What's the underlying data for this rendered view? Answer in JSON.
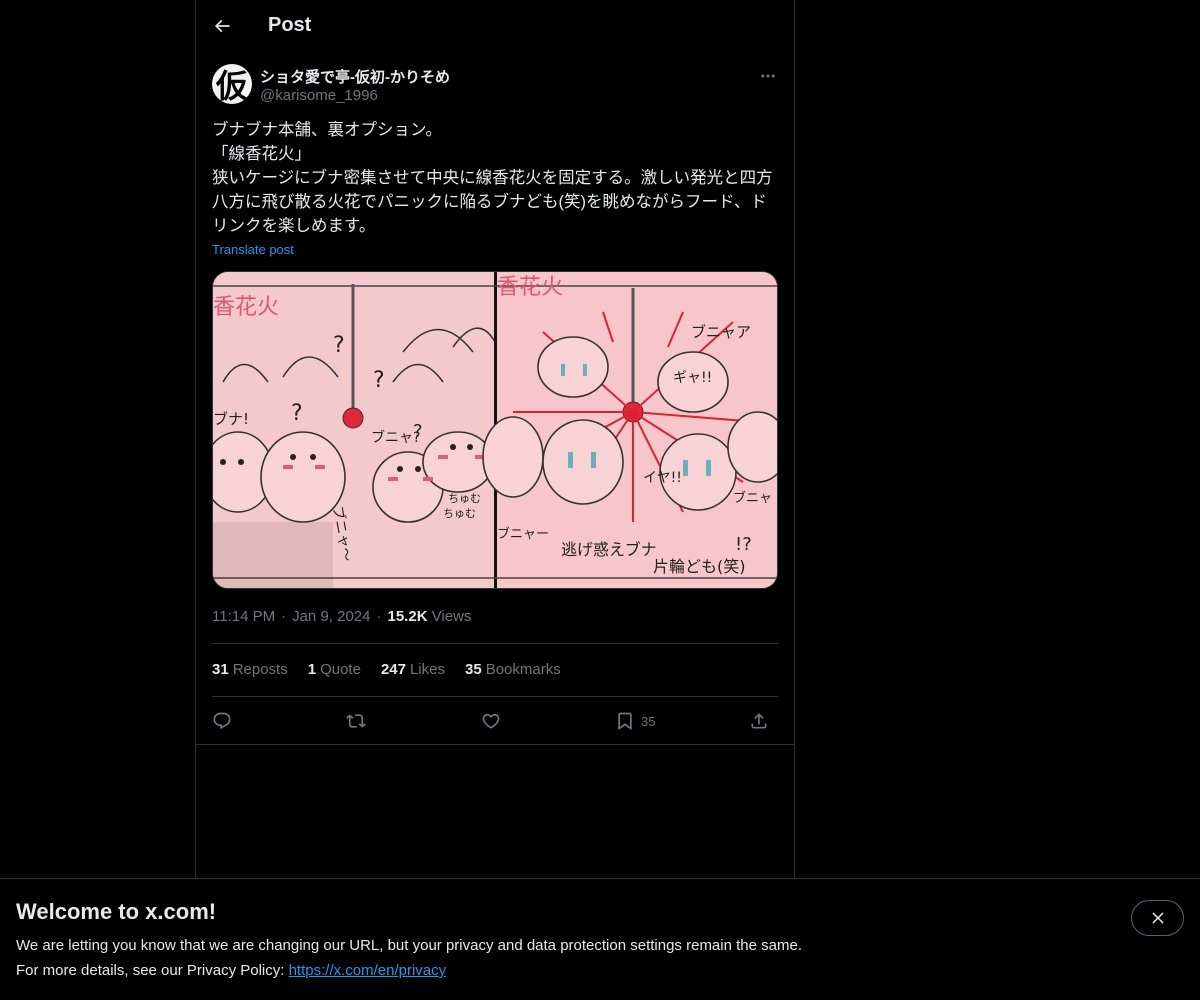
{
  "header": {
    "title": "Post"
  },
  "author": {
    "avatar_glyph": "仮",
    "display_name": "ショタ愛で亭-仮初-かりそめ",
    "handle": "@karisome_1996"
  },
  "tweet": {
    "text": "ブナブナ本舗、裏オプション。\n「線香花火」\n狭いケージにブナ密集させて中央に線香花火を固定する。激しい発光と四方八方に飛び散る火花でパニックに陥るブナども(笑)を眺めながらフード、ドリンクを楽しめます。",
    "translate_label": "Translate post"
  },
  "media": {
    "left_panel": {
      "heading": "香花火",
      "texts": [
        "ブナ!",
        "ブニャ?",
        "ブニャ～",
        "ちゅむ",
        "ちゅむ",
        "?",
        "?",
        "?",
        "?"
      ]
    },
    "right_panel": {
      "heading": "香花火",
      "texts": [
        "ブニャア",
        "ブニャー",
        "ギャ!!",
        "イヤ!!",
        "ブニャ",
        "逃げ惑えブナ",
        "片輪ども(笑)",
        "!?"
      ]
    }
  },
  "meta": {
    "time": "11:14 PM",
    "date": "Jan 9, 2024",
    "views_count": "15.2K",
    "views_label": "Views"
  },
  "stats": [
    {
      "count": "31",
      "label": "Reposts"
    },
    {
      "count": "1",
      "label": "Quote"
    },
    {
      "count": "247",
      "label": "Likes"
    },
    {
      "count": "35",
      "label": "Bookmarks"
    }
  ],
  "actions": {
    "bookmark_count": "35"
  },
  "banner": {
    "title": "Welcome to x.com!",
    "line1": "We are letting you know that we are changing our URL, but your privacy and data protection settings remain the same.",
    "line2_prefix": "For more details, see our Privacy Policy: ",
    "link_text": "https://x.com/en/privacy"
  },
  "colors": {
    "background": "#000000",
    "text_primary": "#e7e9ea",
    "text_secondary": "#71767b",
    "accent": "#1d9bf0",
    "border": "#2f3336"
  }
}
